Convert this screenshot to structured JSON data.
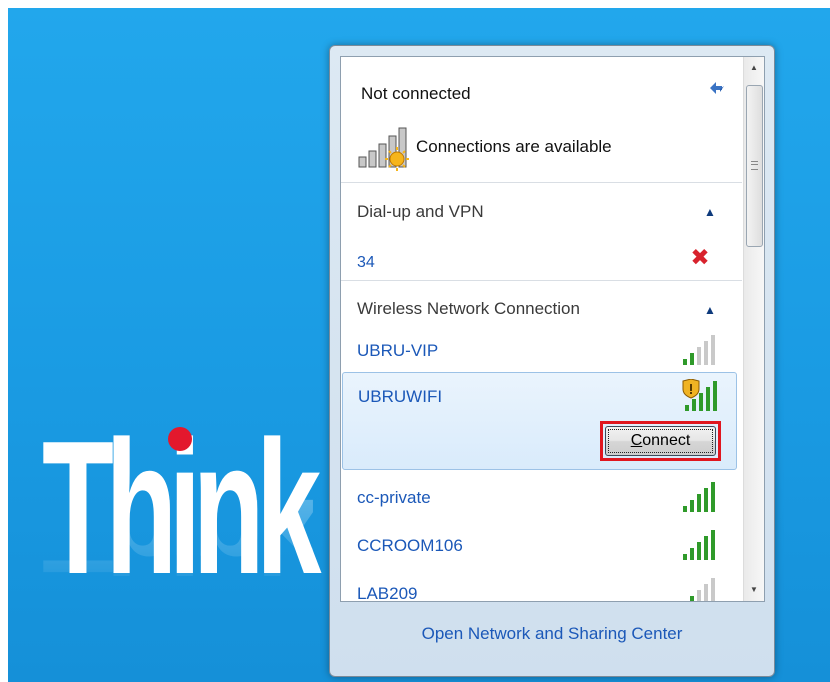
{
  "logo": {
    "text": "Think"
  },
  "flyout": {
    "status_title": "Not connected",
    "availability_text": "Connections are available",
    "dialup_group": {
      "label": "Dial-up and VPN",
      "items": [
        {
          "name": "34",
          "status": "disconnected"
        }
      ]
    },
    "wireless_group": {
      "label": "Wireless Network Connection",
      "networks": [
        {
          "name": "UBRU-VIP",
          "signal_bars": 2,
          "secured": false
        },
        {
          "name": "UBRUWIFI",
          "signal_bars": 5,
          "secured": true,
          "selected": true
        },
        {
          "name": "cc-private",
          "signal_bars": 5,
          "secured": false
        },
        {
          "name": "CCROOM106",
          "signal_bars": 5,
          "secured": false
        },
        {
          "name": "LAB209",
          "signal_bars": 2,
          "secured": false
        }
      ]
    },
    "connect_button": {
      "prefix": "C",
      "rest": "onnect"
    },
    "footer_link": "Open Network and Sharing Center"
  },
  "colors": {
    "desktop_blue": "#1a9be3",
    "link_blue": "#1b58b8",
    "signal_green": "#2f9a2a",
    "highlight_red": "#e0161f",
    "logo_dot_red": "#e3182d"
  },
  "icons": {
    "refresh": "refresh-icon",
    "availability": "network-available-icon",
    "collapse": "chevron-up-icon",
    "disconnect": "red-x-icon",
    "signal": "signal-bars-icon",
    "shield": "security-shield-icon"
  }
}
